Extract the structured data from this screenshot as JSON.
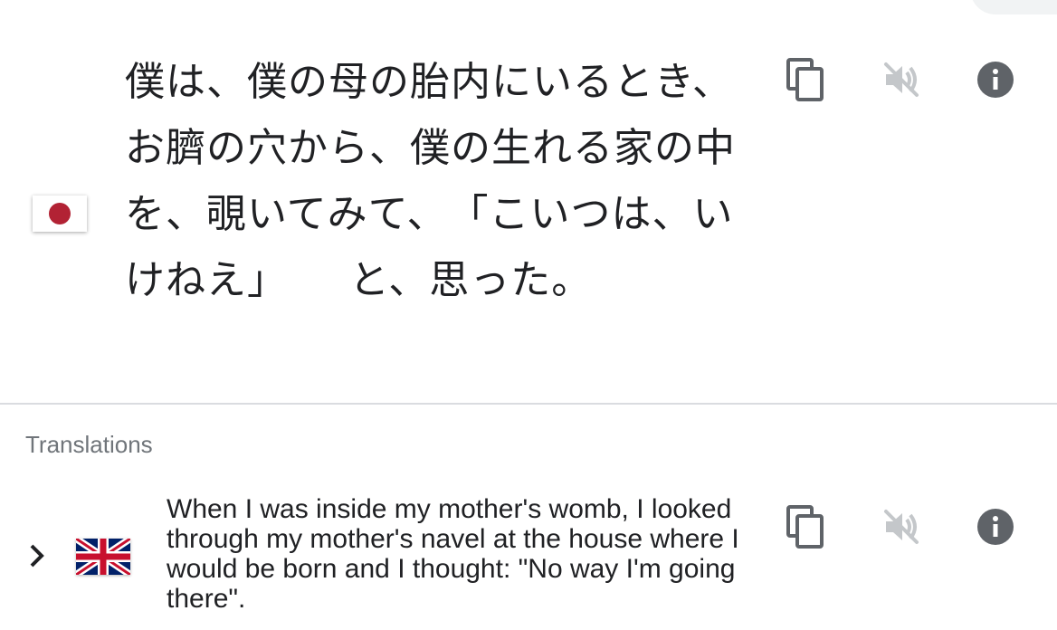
{
  "source": {
    "language_flag": "japan-flag",
    "text": "僕は、僕の母の胎内にいるとき、お臍の穴から、僕の生れる家の中を、覗いてみて、　「こいつは、いけねえ」　　と、思った。",
    "actions": {
      "copy_icon": "copy-icon",
      "speaker_icon": "speaker-muted-icon",
      "info_icon": "info-icon"
    }
  },
  "translations": {
    "section_label": "Translations",
    "items": [
      {
        "language_flag": "uk-flag",
        "text": "When I was inside my mother's womb, I looked through my mother's navel at the house where I would be born and I thought: \"No way I'm going there\".",
        "expand_icon": "chevron-right-icon"
      }
    ]
  },
  "colors": {
    "text": "#202124",
    "icon_active": "#5f6368",
    "icon_disabled": "#c4c7ca",
    "divider": "#dadce0",
    "label": "#70757a",
    "jp_sun": "#b22234"
  }
}
